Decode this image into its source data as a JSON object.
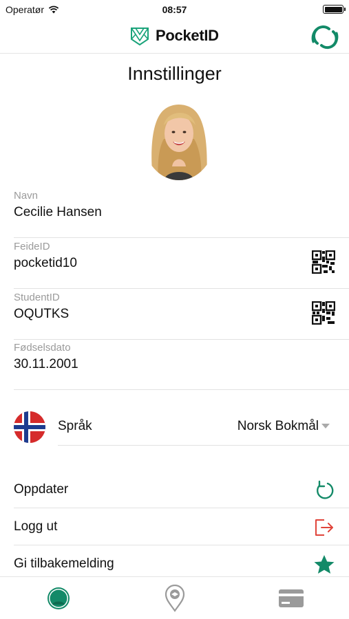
{
  "status_bar": {
    "carrier": "Operatør",
    "time": "08:57"
  },
  "header": {
    "brand": "PocketID"
  },
  "page": {
    "title": "Innstillinger"
  },
  "profile_fields": [
    {
      "label": "Navn",
      "value": "Cecilie Hansen",
      "has_qr": false
    },
    {
      "label": "FeideID",
      "value": "pocketid10",
      "has_qr": true
    },
    {
      "label": "StudentID",
      "value": "OQUTKS",
      "has_qr": true
    },
    {
      "label": "Fødselsdato",
      "value": "30.11.2001",
      "has_qr": false
    }
  ],
  "language": {
    "label": "Språk",
    "selected": "Norsk Bokmål",
    "flag": "norway-flag-icon"
  },
  "actions": [
    {
      "label": "Oppdater",
      "icon": "refresh-icon"
    },
    {
      "label": "Logg ut",
      "icon": "logout-icon"
    },
    {
      "label": "Gi tilbakemelding",
      "icon": "star-icon"
    }
  ],
  "tabs": [
    {
      "icon": "profile-icon",
      "active": true
    },
    {
      "icon": "location-pin-icon",
      "active": false
    },
    {
      "icon": "card-icon",
      "active": false
    }
  ],
  "colors": {
    "accent": "#138a68",
    "logout": "#e0443a",
    "inactive": "#9a9a9a"
  }
}
